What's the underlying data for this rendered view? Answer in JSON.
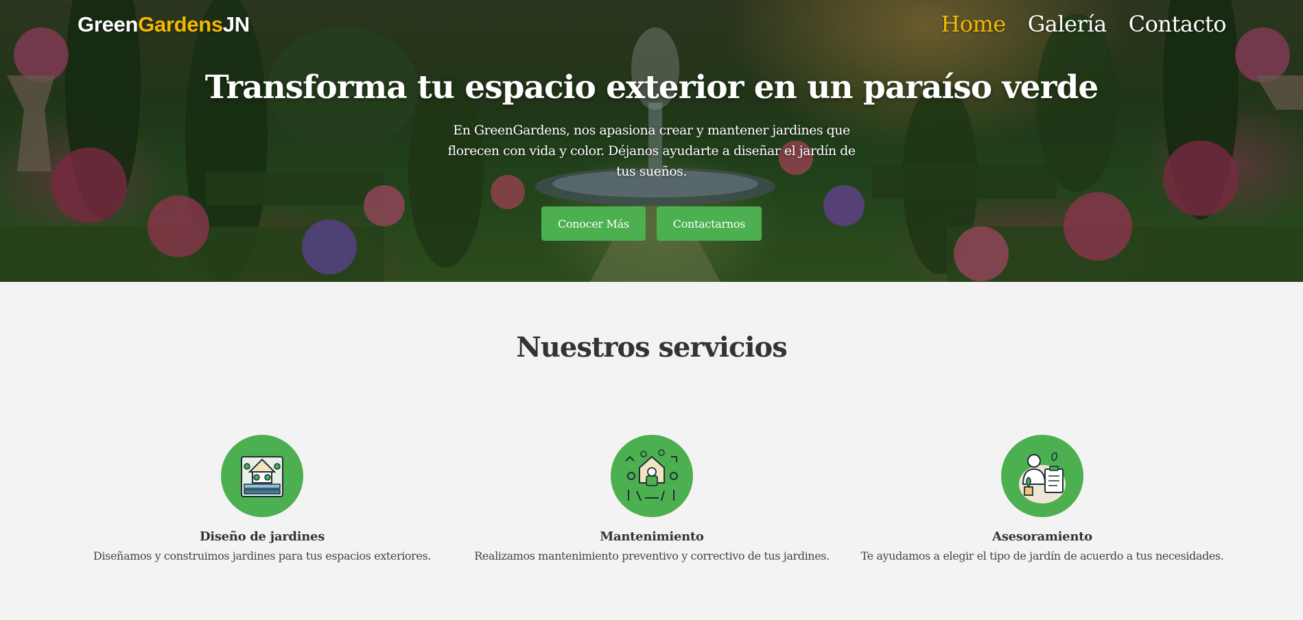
{
  "header": {
    "logo": {
      "part1": "Green",
      "part2": "Gardens",
      "part3": "JN"
    },
    "nav": [
      {
        "label": "Home",
        "active": true
      },
      {
        "label": "Galería",
        "active": false
      },
      {
        "label": "Contacto",
        "active": false
      }
    ]
  },
  "hero": {
    "title": "Transforma tu espacio exterior en un paraíso verde",
    "text": "En GreenGardens, nos apasiona crear y mantener jardines que florecen con vida y color. Déjanos ayudarte a diseñar el jardín de tus sueños.",
    "buttons": [
      {
        "label": "Conocer Más"
      },
      {
        "label": "Contactarnos"
      }
    ]
  },
  "services": {
    "title": "Nuestros servicios",
    "items": [
      {
        "icon": "garden-design-icon",
        "name": "Diseño de jardines",
        "description": "Diseñamos y construimos jardines para tus espacios exteriores."
      },
      {
        "icon": "garden-maintenance-icon",
        "name": "Mantenimiento",
        "description": "Realizamos mantenimiento preventivo y correctivo de tus jardines."
      },
      {
        "icon": "gardener-advice-icon",
        "name": "Asesoramiento",
        "description": "Te ayudamos a elegir el tipo de jardín de acuerdo a tus necesidades."
      }
    ]
  },
  "colors": {
    "accent": "#f5b800",
    "button": "#4caf50",
    "section_bg": "#f3f3f3",
    "heading": "#333333"
  }
}
